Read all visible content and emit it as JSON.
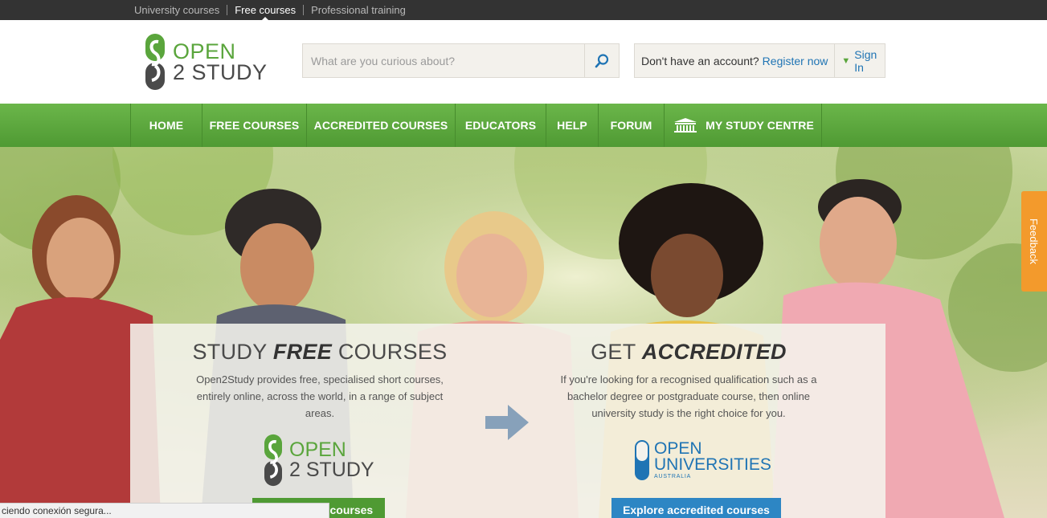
{
  "topbar": {
    "links": [
      {
        "label": "University courses"
      },
      {
        "label": "Free courses"
      },
      {
        "label": "Professional training"
      }
    ]
  },
  "header": {
    "logo": {
      "line1": "OPEN",
      "line2": "2 STUDY"
    },
    "search": {
      "placeholder": "What are you curious about?"
    },
    "account": {
      "question": "Don't have an account?",
      "register": "Register now",
      "signin": "Sign In"
    }
  },
  "nav": {
    "items": [
      {
        "label": "HOME"
      },
      {
        "label": "FREE COURSES"
      },
      {
        "label": "ACCREDITED COURSES"
      },
      {
        "label": "EDUCATORS"
      },
      {
        "label": "HELP"
      },
      {
        "label": "FORUM"
      },
      {
        "label": "MY STUDY CENTRE"
      }
    ]
  },
  "hero": {
    "left": {
      "title_pre": "STUDY ",
      "title_em": "FREE",
      "title_post": " COURSES",
      "text": "Open2Study provides free, specialised short courses, entirely online, across the world, in a range of subject areas.",
      "logo_line1": "OPEN",
      "logo_line2": "2 STUDY",
      "cta": "e courses"
    },
    "right": {
      "title_pre": "GET ",
      "title_em": "ACCREDITED",
      "text": "If you're looking for a recognised qualification such as a bachelor degree or postgraduate course, then online university study is the right choice for you.",
      "logo_line1": "OPEN",
      "logo_line2": "UNIVERSITIES",
      "logo_line3": "AUSTRALIA",
      "cta": "Explore accredited courses"
    }
  },
  "feedback": {
    "label": "Feedback"
  },
  "statusbar": {
    "text": "ciendo conexión segura..."
  },
  "colors": {
    "brand_green": "#5aa53c",
    "brand_blue": "#1f74b4",
    "topbar": "#333333",
    "feedback_orange": "#f39a2c"
  }
}
